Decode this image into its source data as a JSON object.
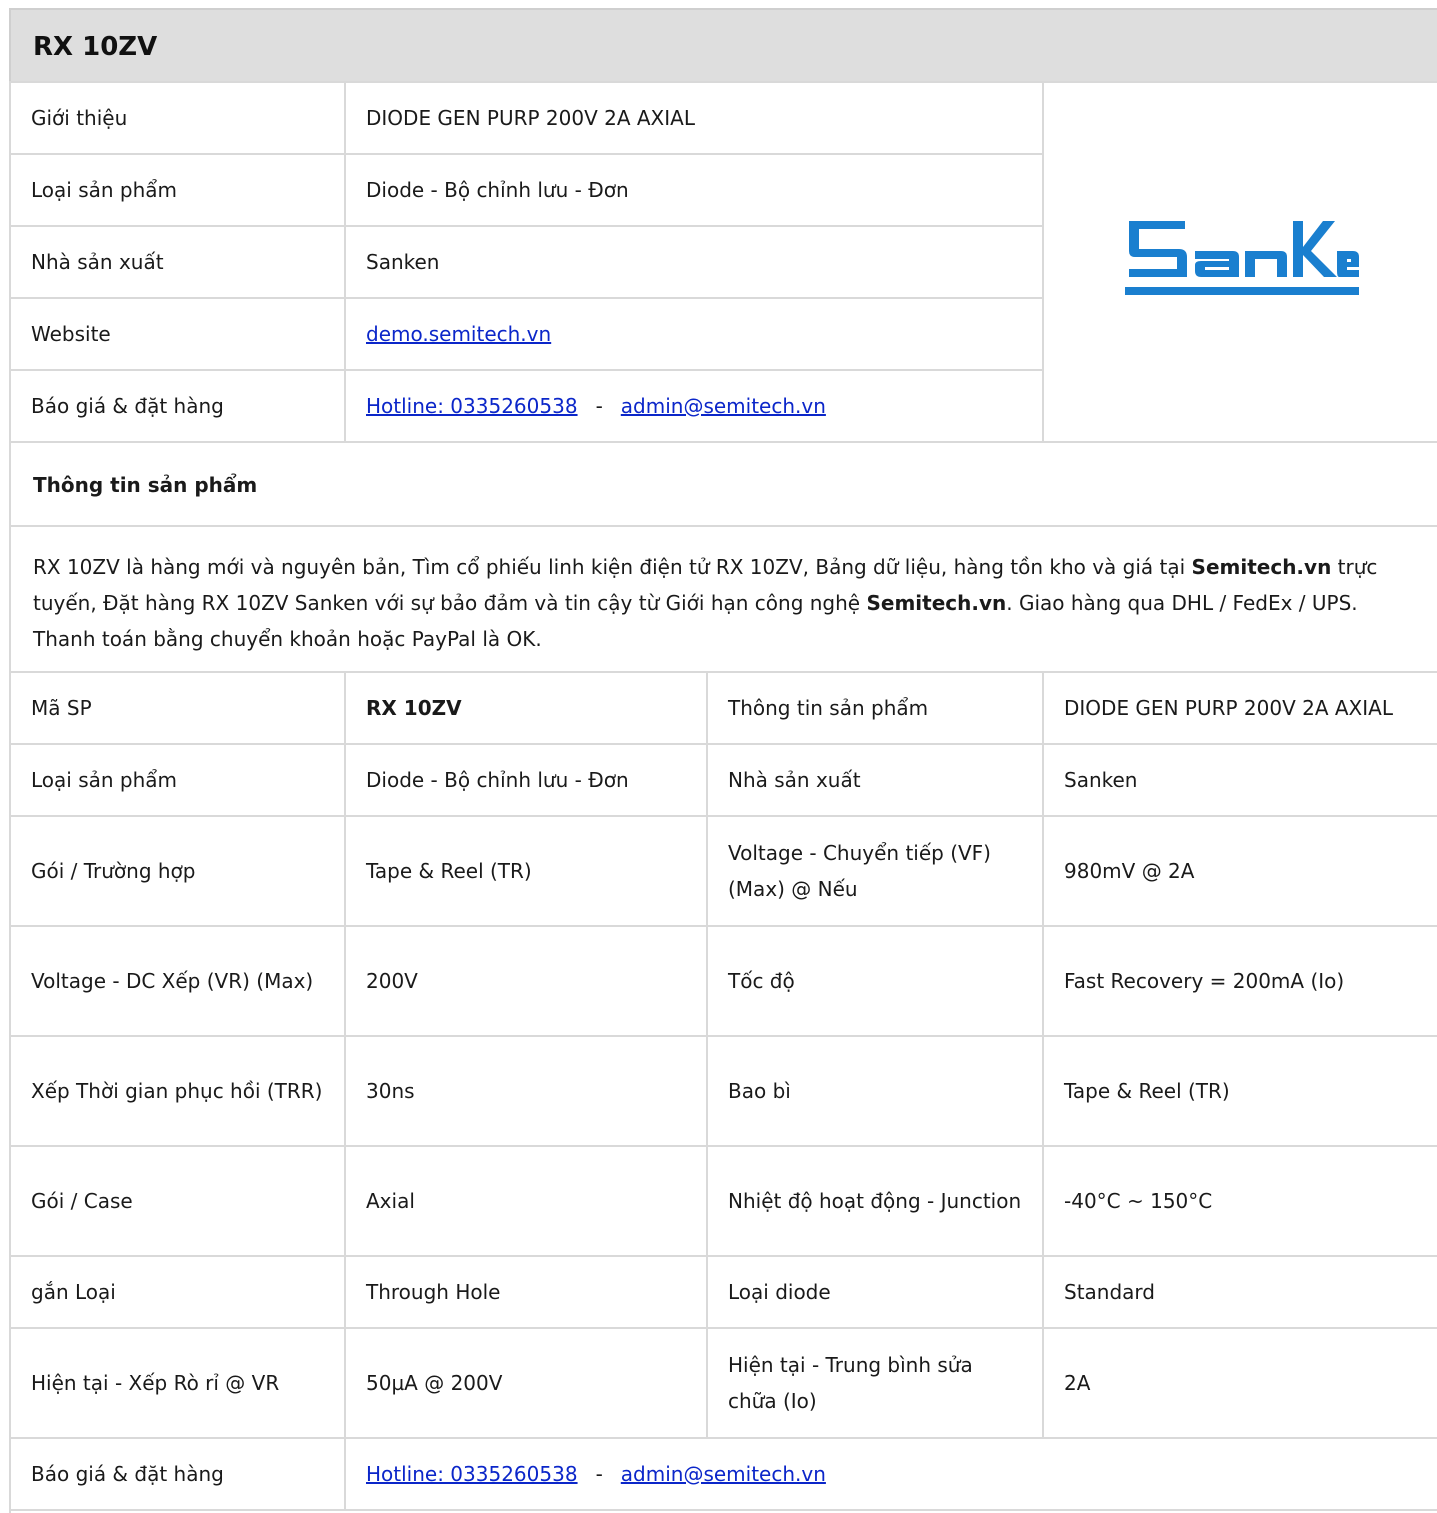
{
  "title": "RX 10ZV",
  "info": {
    "intro_label": "Giới thiệu",
    "intro_value": "DIODE GEN PURP 200V 2A AXIAL",
    "type_label": "Loại sản phẩm",
    "type_value": "Diode - Bộ chỉnh lưu - Đơn",
    "maker_label": "Nhà sản xuất",
    "maker_value": "Sanken",
    "website_label": "Website",
    "website_link": "demo.semitech.vn",
    "order_label": "Báo giá & đặt hàng",
    "hotline": "Hotline: 0335260538",
    "separator": "-",
    "email": "admin@semitech.vn",
    "logo_text": "SanKen",
    "logo_color": "#1a7fcf"
  },
  "section": {
    "heading": "Thông tin sản phẩm",
    "desc_1": "RX 10ZV là hàng mới và nguyên bản, Tìm cổ phiếu linh kiện điện tử RX 10ZV, Bảng dữ liệu, hàng tồn kho và giá tại ",
    "desc_bold_1": "Semitech.vn",
    "desc_2": " trực tuyến, Đặt hàng RX 10ZV Sanken với sự bảo đảm và tin cậy từ Giới hạn công nghệ ",
    "desc_bold_2": "Semitech.vn",
    "desc_3": ". Giao hàng qua DHL / FedEx / UPS. Thanh toán bằng chuyển khoản hoặc PayPal là OK."
  },
  "specs": [
    {
      "l1": "Mã SP",
      "v1": "RX 10ZV",
      "l2": "Thông tin sản phẩm",
      "v2": "DIODE GEN PURP 200V 2A AXIAL"
    },
    {
      "l1": "Loại sản phẩm",
      "v1": "Diode - Bộ chỉnh lưu - Đơn",
      "l2": "Nhà sản xuất",
      "v2": "Sanken"
    },
    {
      "l1": "Gói / Trường hợp",
      "v1": "Tape & Reel (TR)",
      "l2": "Voltage - Chuyển tiếp (VF) (Max) @ Nếu",
      "v2": "980mV @ 2A"
    },
    {
      "l1": "Voltage - DC Xếp (VR) (Max)",
      "v1": "200V",
      "l2": "Tốc độ",
      "v2": "Fast Recovery = 200mA (Io)"
    },
    {
      "l1": "Xếp Thời gian phục hồi (TRR)",
      "v1": "30ns",
      "l2": "Bao bì",
      "v2": "Tape & Reel (TR)"
    },
    {
      "l1": "Gói / Case",
      "v1": "Axial",
      "l2": "Nhiệt độ hoạt động - Junction",
      "v2": "-40°C ~ 150°C"
    },
    {
      "l1": "gắn Loại",
      "v1": "Through Hole",
      "l2": "Loại diode",
      "v2": "Standard"
    },
    {
      "l1": "Hiện tại - Xếp Rò rỉ @ VR",
      "v1": "50µA @ 200V",
      "l2": "Hiện tại - Trung bình sửa chữa (Io)",
      "v2": "2A"
    }
  ],
  "footer": {
    "order_label": "Báo giá & đặt hàng",
    "hotline": "Hotline: 0335260538",
    "separator": "-",
    "email": "admin@semitech.vn"
  }
}
